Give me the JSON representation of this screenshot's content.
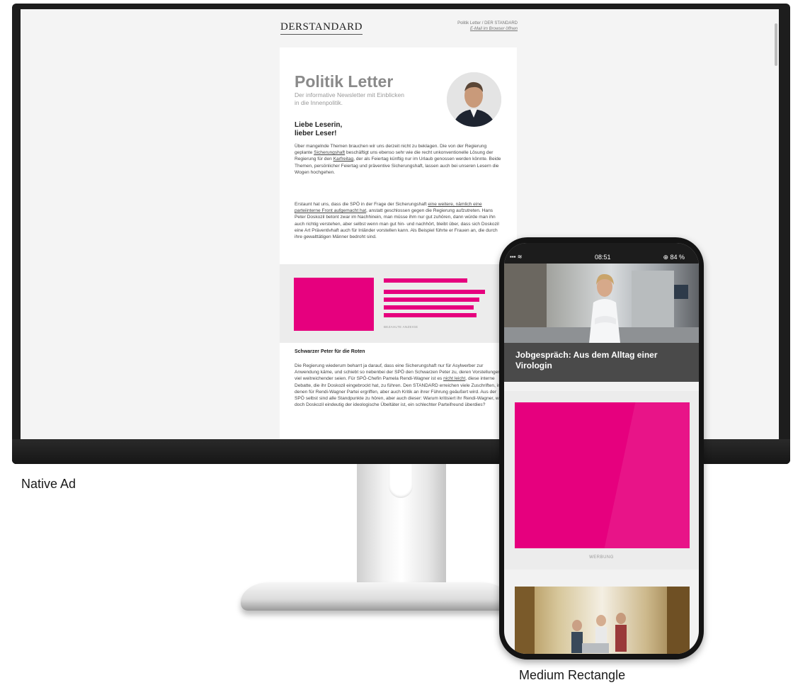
{
  "captions": {
    "left": "Native Ad",
    "right": "Medium Rectangle"
  },
  "newsletter": {
    "logo": "DERSTANDARD",
    "header_right": "Politik Letter / DER STANDARD",
    "browser_link": "E-Mail im Browser öffnen",
    "title": "Politik Letter",
    "subtitle": "Der informative Newsletter mit Einblicken in die Innenpolitik.",
    "greeting_line1": "Liebe Leserin,",
    "greeting_line2": "lieber Leser!",
    "para1": {
      "a": "Über mangelnde Themen brauchen wir uns derzeit nicht zu beklagen. Die von der Regierung geplante ",
      "link1": "Sicherungshaft",
      "b": " beschäftigt uns ebenso sehr wie die recht unkonventionelle Lösung der Regierung für den ",
      "link2": "Karfreitag",
      "c": ", der als Feiertag künftig nur im Urlaub genossen werden könnte. Beide Themen, persönlicher Feiertag und präventive Sicherungshaft, lassen auch bei unseren Lesern die Wogen hochgehen."
    },
    "para2": {
      "a": "Erstaunt hat uns, dass die SPÖ in der Frage der Sicherungshaft ",
      "link1": "eine weitere, nämlich eine parteiinterne Front aufgemacht hat",
      "b": ", anstatt geschlossen gegen die Regierung aufzutreten. Hans Peter Doskozil betont zwar im Nachhinein, man müsse ihm nur gut zuhören, dann würde man ihn auch richtig verstehen, aber selbst wenn man gut hin- und nachhört, bleibt über, dass sich Doskozil eine Art Präventivhaft auch für Inländer vorstellen kann. Als Beispiel führte er Frauen an, die durch ihre gewalttätigen Männer bedroht sind."
    },
    "ad_label": "BEZAHLTE ANZEIGE",
    "section_title": "Schwarzer Peter für die Roten",
    "para3": {
      "a": "Die Regierung wiederum beharrt ja darauf, dass eine Sicherungshaft nur für Asylwerber zur Anwendung käme, und schiebt so nebenbei der SPÖ den Schwarzen Peter zu, deren Vorstellungen viel weitreichender seien. Für SPÖ-Chefin Pamela Rendi-Wagner ist es ",
      "link1": "nicht leicht",
      "b": ", diese interne Debatte, die ihr Doskozil eingebrockt hat, zu führen. Den STANDARD erreichen viele Zuschriften, in denen für Rendi-Wagner Partei ergriffen, aber auch Kritik an ihrer Führung geäußert wird. Aus der SPÖ selbst sind alle Standpunkte zu hören, aber auch dieser: Warum kritisiert ihr Rendi-Wagner, wo doch Doskozil eindeutig der ideologische Übeltäter ist, ein schlechter Parteifreund überdies?"
    }
  },
  "phone": {
    "time": "08:51",
    "battery": "⊕ 84 %",
    "article_title": "Jobgespräch: Aus dem Alltag einer Virologin",
    "ad_label": "WERBUNG"
  },
  "colors": {
    "ad_magenta": "#e6007e",
    "title_gray": "#8a8a8a"
  }
}
